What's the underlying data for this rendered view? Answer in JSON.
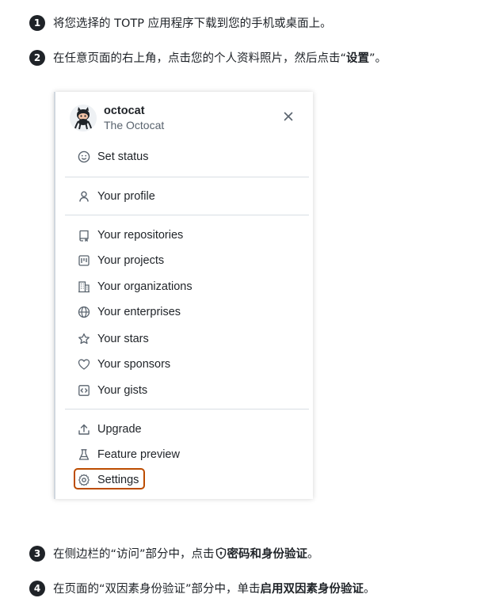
{
  "steps": [
    {
      "num": "1",
      "text": "将您选择的 TOTP 应用程序下载到您的手机或桌面上。"
    },
    {
      "num": "2",
      "pre": "在任意页面的右上角，点击您的个人资料照片，然后点击“",
      "bold": "设置",
      "post": "”。"
    },
    {
      "num": "3",
      "pre": "在侧边栏的“访问”部分中，点击",
      "bold": "密码和身份验证",
      "post": "。"
    },
    {
      "num": "4",
      "pre": "在页面的“双因素身份验证”部分中，单击",
      "bold": "启用双因素身份验证",
      "post": "。"
    }
  ],
  "menu": {
    "username": "octocat",
    "fullname": "The Octocat",
    "items": [
      {
        "label": "Set status",
        "icon": "smiley-icon"
      },
      {
        "label": "Your profile",
        "icon": "person-icon"
      },
      {
        "label": "Your repositories",
        "icon": "repo-icon"
      },
      {
        "label": "Your projects",
        "icon": "project-icon"
      },
      {
        "label": "Your organizations",
        "icon": "organization-icon"
      },
      {
        "label": "Your enterprises",
        "icon": "globe-icon"
      },
      {
        "label": "Your stars",
        "icon": "star-icon"
      },
      {
        "label": "Your sponsors",
        "icon": "heart-icon"
      },
      {
        "label": "Your gists",
        "icon": "code-square-icon"
      },
      {
        "label": "Upgrade",
        "icon": "upload-icon"
      },
      {
        "label": "Feature preview",
        "icon": "beaker-icon"
      },
      {
        "label": "Settings",
        "icon": "gear-icon"
      }
    ]
  },
  "colors": {
    "highlight": "#bc4c00",
    "text": "#1f2328",
    "muted": "#59636e"
  }
}
